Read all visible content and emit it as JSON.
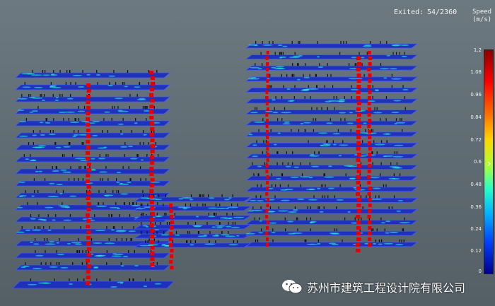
{
  "hud": {
    "exited_label": "Exited:",
    "exited_count": "54/2360",
    "speed_title_line1": "Speed",
    "speed_title_line2": "(m/s)"
  },
  "legend": {
    "ticks": [
      "1.2",
      "1.08",
      "0.96",
      "0.84",
      "0.72",
      "0.6",
      "0.48",
      "0.36",
      "0.24",
      "0.12",
      "0"
    ]
  },
  "watermark": {
    "icon": "wechat-icon",
    "text": "苏州市建筑工程设计院有限公司"
  },
  "colors": {
    "floor": "#1c2fbf",
    "floor_edge": "#3f58ff",
    "stair": "#e80000",
    "agent": "#111111",
    "hot_speed": "#26ffd0"
  }
}
